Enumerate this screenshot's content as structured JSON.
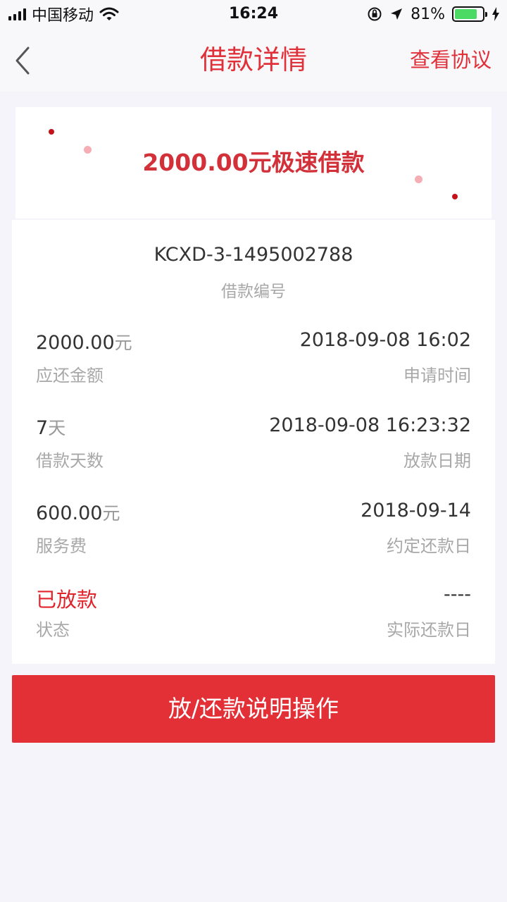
{
  "status_bar": {
    "carrier": "中国移动",
    "time": "16:24",
    "battery_percent": "81%",
    "battery_level": 0.81
  },
  "nav": {
    "title": "借款详情",
    "action": "查看协议"
  },
  "header": {
    "title": "2000.00元极速借款"
  },
  "loan": {
    "id": "KCXD-3-1495002788",
    "id_label": "借款编号",
    "rows": [
      {
        "left_value": "2000.00",
        "left_unit": "元",
        "left_label": "应还金额",
        "right_value": "2018-09-08 16:02",
        "right_label": "申请时间"
      },
      {
        "left_value": "7",
        "left_unit": "天",
        "left_label": "借款天数",
        "right_value": "2018-09-08 16:23:32",
        "right_label": "放款日期"
      },
      {
        "left_value": "600.00",
        "left_unit": "元",
        "left_label": "服务费",
        "right_value": "2018-09-14",
        "right_label": "约定还款日"
      },
      {
        "left_value": "已放款",
        "left_label": "状态",
        "right_value": "----",
        "right_label": "实际还款日"
      }
    ]
  },
  "action_button": {
    "label": "放/还款说明操作"
  },
  "colors": {
    "accent": "#e0313a",
    "button": "#e32f36",
    "status": "#e0242c"
  }
}
